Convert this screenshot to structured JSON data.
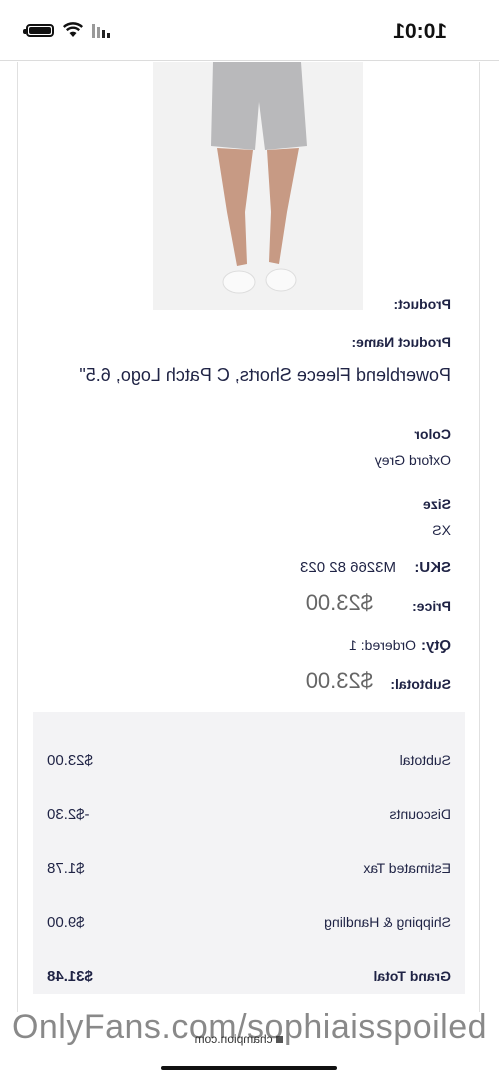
{
  "status": {
    "time": "10:01"
  },
  "order": {
    "product_label": "Product:",
    "product_name_label": "Product Name:",
    "product_name": "Powerblend Fleece Shorts, C Patch Logo, 6.5\"",
    "color_label": "Color",
    "color_value": "Oxford Grey",
    "size_label": "Size",
    "size_value": "XS",
    "sku_label": "SKU:",
    "sku_value": "M3266 82 023",
    "price_label": "Price:",
    "price_value": "$23.00",
    "qty_label": "Qty:",
    "qty_value": "Ordered: 1",
    "subtotal_label": "Subtotal:",
    "subtotal_value": "$23.00"
  },
  "summary": [
    {
      "label": "Subtotal",
      "value": "$23.00"
    },
    {
      "label": "Discounts",
      "value": "-$2.30"
    },
    {
      "label": "Estimated Tax",
      "value": "$1.78"
    },
    {
      "label": "Shipping & Handling",
      "value": "$9.00"
    },
    {
      "label": "Grand Total",
      "value": "$31.48"
    }
  ],
  "browser": {
    "url": "champion.com"
  },
  "watermark": "OnlyFans.com/sophiaisspoiled",
  "icons": {
    "wifi": "wifi-icon",
    "battery": "battery-icon",
    "signal": "signal-icon",
    "lock": "lock-icon"
  }
}
